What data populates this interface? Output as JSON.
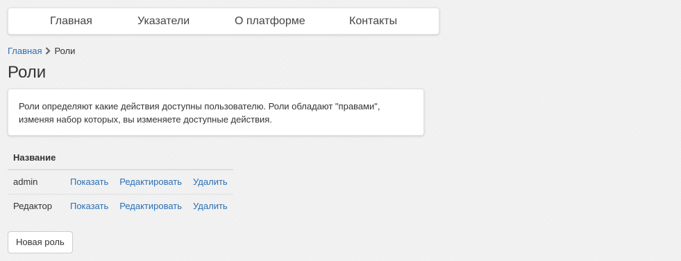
{
  "nav": {
    "items": [
      {
        "label": "Главная"
      },
      {
        "label": "Указатели"
      },
      {
        "label": "О платформе"
      },
      {
        "label": "Контакты"
      }
    ]
  },
  "breadcrumb": {
    "home": "Главная",
    "current": "Роли"
  },
  "page": {
    "title": "Роли",
    "description": "Роли определяют какие действия доступны пользователю. Роли обладают \"правами\", изменяя набор которых, вы изменяете доступные действия."
  },
  "table": {
    "header_name": "Название",
    "rows": [
      {
        "name": "admin",
        "show": "Показать",
        "edit": "Редактировать",
        "delete": "Удалить"
      },
      {
        "name": "Редактор",
        "show": "Показать",
        "edit": "Редактировать",
        "delete": "Удалить"
      }
    ]
  },
  "actions": {
    "new_role": "Новая роль"
  },
  "colors": {
    "link": "#2a6fb4",
    "background": "#f1f1f1"
  },
  "icons": {
    "breadcrumb_separator": "chevron-right-icon"
  }
}
